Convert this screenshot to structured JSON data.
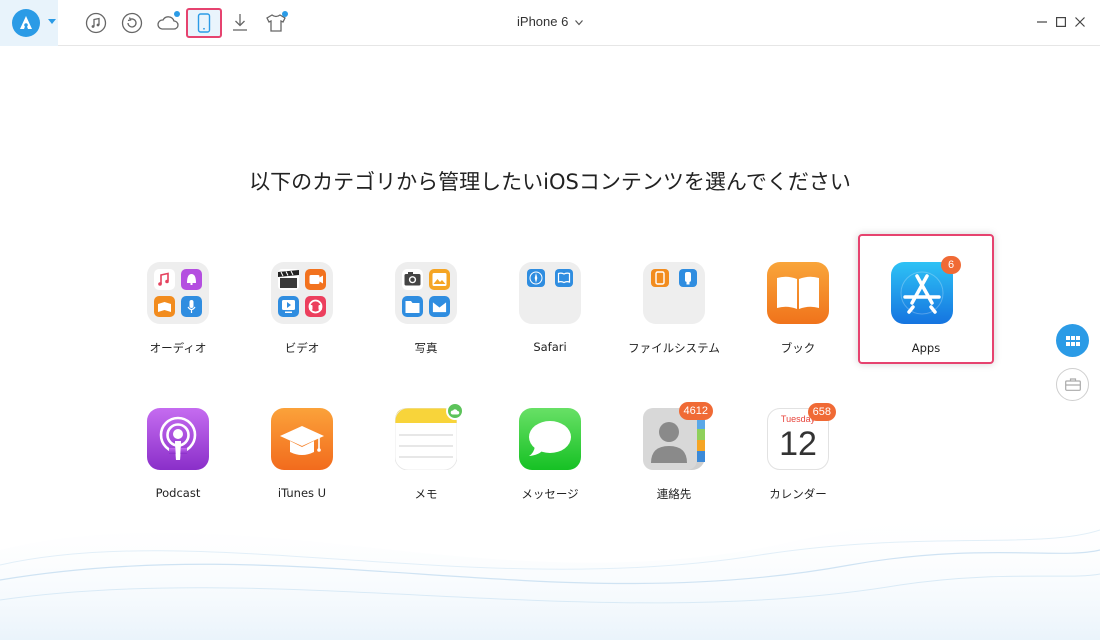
{
  "toolbar": {
    "device_name": "iPhone 6",
    "icons": [
      "music-icon",
      "restore-icon",
      "icloud-icon",
      "device-icon",
      "download-icon",
      "tshirt-icon"
    ]
  },
  "heading": "以下のカテゴリから管理したいiOSコンテンツを選んでください",
  "categories": [
    {
      "label": "オーディオ",
      "icon": "audio-folder-icon"
    },
    {
      "label": "ビデオ",
      "icon": "video-folder-icon"
    },
    {
      "label": "写真",
      "icon": "photo-folder-icon"
    },
    {
      "label": "Safari",
      "icon": "safari-folder-icon"
    },
    {
      "label": "ファイルシステム",
      "icon": "filesystem-folder-icon"
    },
    {
      "label": "ブック",
      "icon": "books-icon"
    },
    {
      "label": "Apps",
      "icon": "app-store-icon",
      "badge": "6"
    },
    {
      "label": "Podcast",
      "icon": "podcast-icon"
    },
    {
      "label": "iTunes U",
      "icon": "itunes-u-icon"
    },
    {
      "label": "メモ",
      "icon": "notes-icon"
    },
    {
      "label": "メッセージ",
      "icon": "messages-icon"
    },
    {
      "label": "連絡先",
      "icon": "contacts-icon",
      "badge": "4612"
    },
    {
      "label": "カレンダー",
      "icon": "calendar-icon",
      "badge": "658",
      "calendar_day": "Tuesday",
      "calendar_date": "12"
    }
  ],
  "colors": {
    "accent": "#2b9be6",
    "selection": "#e6436f",
    "badge": "#f06a35"
  }
}
